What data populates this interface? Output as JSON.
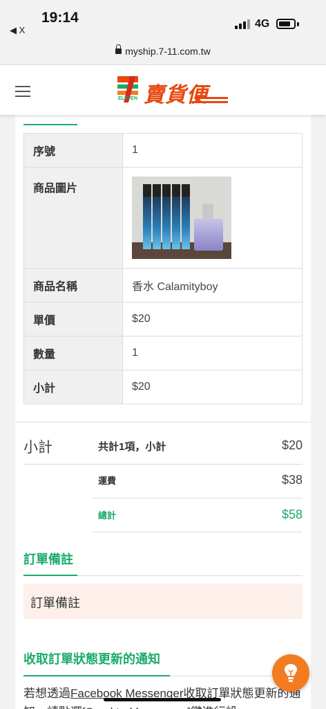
{
  "status_bar": {
    "time": "19:14",
    "back_app": "◀ X",
    "network": "4G"
  },
  "browser": {
    "url": "myship.7-11.com.tw"
  },
  "header": {
    "logo_text": "賣貨便",
    "logo_brand": "ELEVEN",
    "more": "•••"
  },
  "product_table": {
    "rows": [
      {
        "label": "序號",
        "value": "1"
      },
      {
        "label": "商品圖片",
        "value": ""
      },
      {
        "label": "商品名稱",
        "value": "香水 Calamityboy"
      },
      {
        "label": "單價",
        "value": "$20"
      },
      {
        "label": "數量",
        "value": "1"
      },
      {
        "label": "小計",
        "value": "$20"
      }
    ]
  },
  "summary": {
    "title": "小計",
    "items": [
      {
        "label": "共計1項，小計",
        "value": "$20"
      },
      {
        "label": "運費",
        "value": "$38"
      },
      {
        "label": "總計",
        "value": "$58"
      }
    ]
  },
  "order_note": {
    "title": "訂單備註",
    "placeholder": "訂單備註"
  },
  "notification": {
    "title": "收取訂單狀態更新的通知",
    "text_before": "若想透過",
    "link_text": "Facebook Messenger",
    "text_after": "收取訂單狀態更新的通知，請點選[Send to Messenger]鍵進行設"
  },
  "colors": {
    "accent_green": "#1aab6a",
    "brand_orange": "#e8470f",
    "fab_orange": "#f47c20",
    "note_bg": "#fdf0ea"
  },
  "icons": {
    "menu": "menu-icon",
    "fab": "lightbulb-icon",
    "lock": "lock-icon"
  }
}
